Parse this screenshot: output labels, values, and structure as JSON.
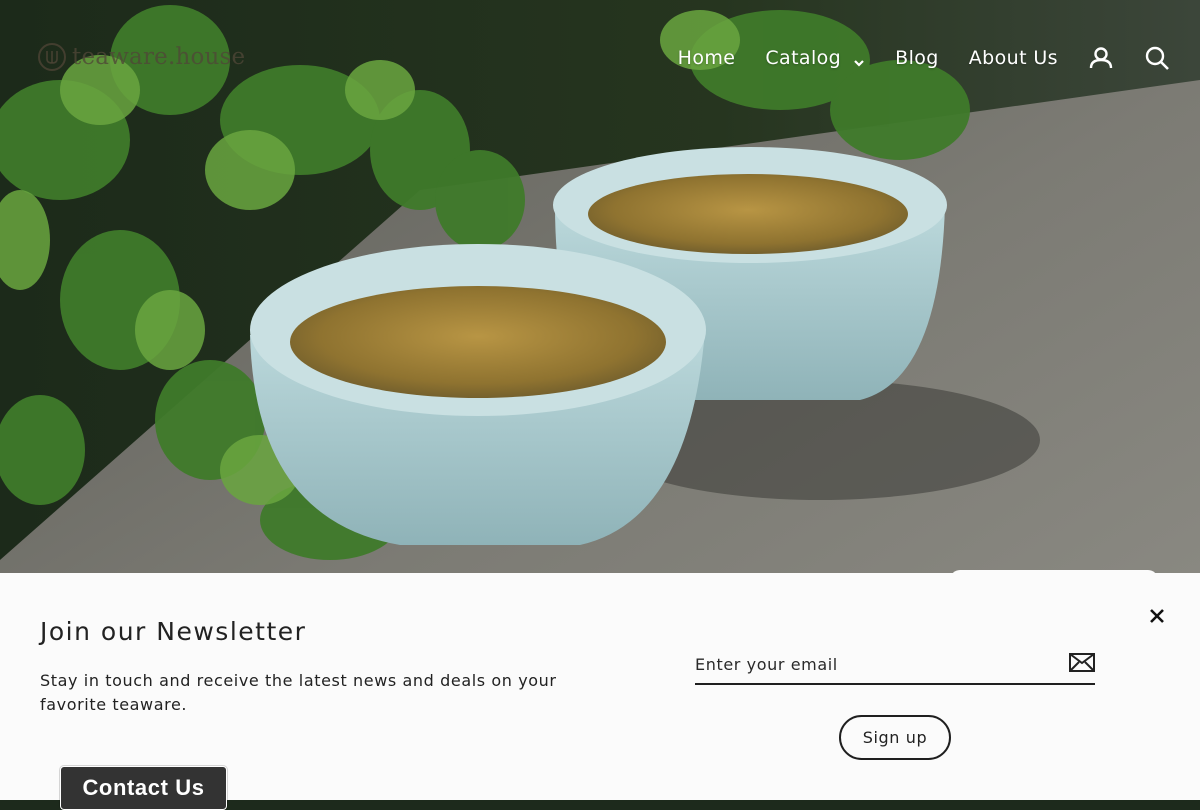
{
  "brand": {
    "name": "teaware.house",
    "icon": "teaware-logo-icon"
  },
  "nav": {
    "items": [
      {
        "label": "Home"
      },
      {
        "label": "Catalog",
        "icon": "chevron-down-icon"
      },
      {
        "label": "Blog"
      },
      {
        "label": "About Us"
      }
    ],
    "icons": [
      "account-icon",
      "search-icon"
    ]
  },
  "newsletter": {
    "title": "Join our Newsletter",
    "description": "Stay in touch and receive the latest news and deals on your favorite teaware.",
    "email_placeholder": "Enter your email",
    "submit_icon": "envelope-icon",
    "signup_label": "Sign up",
    "close_icon": "close-icon"
  },
  "contact": {
    "label": "Contact Us"
  },
  "colors": {
    "panel_background": "#fbfbfb",
    "text": "#222222",
    "contact_background": "#333333",
    "nav_text": "#ffffff"
  }
}
